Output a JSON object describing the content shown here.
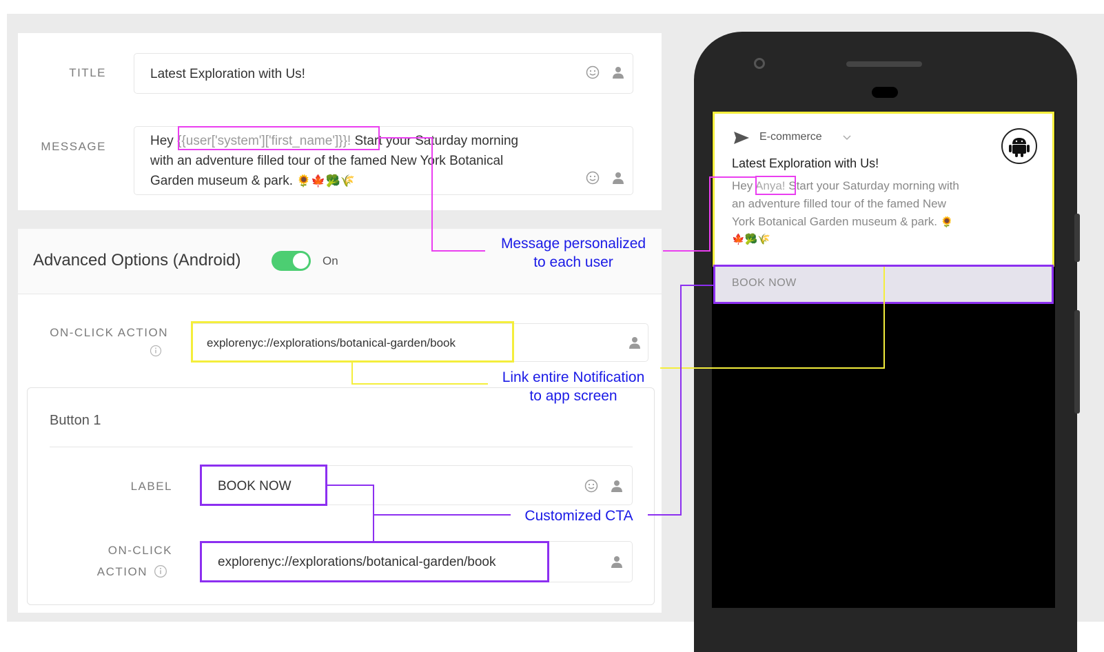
{
  "form": {
    "title_label": "TITLE",
    "title_value": "Latest Exploration with Us!",
    "message_label": "MESSAGE",
    "message_hey": "Hey ",
    "message_token": "{{user['system']['first_name']}}!",
    "message_line1_rest": " Start your Saturday morning",
    "message_line2": "with an adventure filled tour of the famed New York Botanical",
    "message_line3": "Garden museum & park.",
    "message_emojis": "🌻🍁🥦🌾"
  },
  "advanced": {
    "heading": "Advanced Options (Android)",
    "toggle_state": "On",
    "onclick_label": "ON-CLICK ACTION",
    "onclick_value": "explorenyc://explorations/botanical-garden/book"
  },
  "button1": {
    "heading": "Button 1",
    "label_label": "LABEL",
    "label_value": "BOOK NOW",
    "onclick_label_line1": "ON-CLICK",
    "onclick_label_line2": "ACTION",
    "onclick_value": "explorenyc://explorations/botanical-garden/book"
  },
  "annotations": {
    "personalized_line1": "Message personalized",
    "personalized_line2": "to each user",
    "link_line1": "Link entire Notification",
    "link_line2": "to app screen",
    "cta": "Customized CTA"
  },
  "notification": {
    "app_name": "E-commerce",
    "title": "Latest Exploration with Us!",
    "hey": "Hey ",
    "name": "Anya!",
    "line1_rest": " Start your Saturday morning with",
    "line2": "an adventure filled tour of the famed New",
    "line3": "York Botanical Garden museum & park.",
    "line3_emoji": "🌻",
    "line4_emojis": "🍁🥦🌾",
    "action": "BOOK NOW"
  },
  "colors": {
    "magenta": "#ea3ef0",
    "yellow": "#f4ee3c",
    "purple": "#8c2ff0",
    "annotation_blue": "#1a1ae6",
    "toggle_green": "#4cce72"
  },
  "icons": [
    "smiley-icon",
    "person-icon",
    "info-icon",
    "send-icon",
    "chevron-down-icon",
    "android-icon"
  ]
}
